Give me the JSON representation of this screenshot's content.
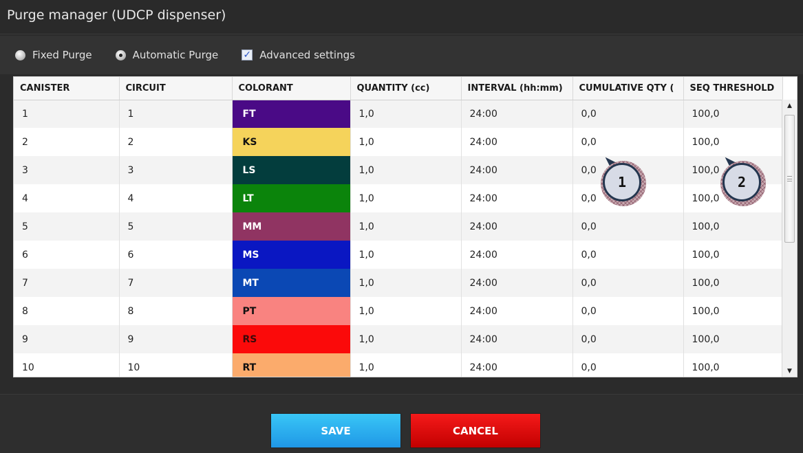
{
  "window": {
    "title": "Purge manager (UDCP dispenser)"
  },
  "options": {
    "fixed_purge": {
      "label": "Fixed Purge",
      "selected": false
    },
    "automatic_purge": {
      "label": "Automatic Purge",
      "selected": true
    },
    "advanced_settings": {
      "label": "Advanced settings",
      "checked": true
    }
  },
  "table": {
    "columns": [
      "CANISTER",
      "CIRCUIT",
      "COLORANT",
      "QUANTITY (cc)",
      "INTERVAL (hh:mm)",
      "CUMULATIVE QTY (",
      "SEQ THRESHOLD"
    ],
    "rows": [
      {
        "canister": "1",
        "circuit": "1",
        "colorant": "FT",
        "colorant_bg": "#4a0a86",
        "colorant_fg": "#ffffff",
        "quantity": "1,0",
        "interval": "24:00",
        "cumulative": "0,0",
        "threshold": "100,0"
      },
      {
        "canister": "2",
        "circuit": "2",
        "colorant": "KS",
        "colorant_bg": "#f5d35b",
        "colorant_fg": "#111111",
        "quantity": "1,0",
        "interval": "24:00",
        "cumulative": "0,0",
        "threshold": "100,0"
      },
      {
        "canister": "3",
        "circuit": "3",
        "colorant": "LS",
        "colorant_bg": "#033d3d",
        "colorant_fg": "#ffffff",
        "quantity": "1,0",
        "interval": "24:00",
        "cumulative": "0,0",
        "threshold": "100,0"
      },
      {
        "canister": "4",
        "circuit": "4",
        "colorant": "LT",
        "colorant_bg": "#0b840b",
        "colorant_fg": "#ffffff",
        "quantity": "1,0",
        "interval": "24:00",
        "cumulative": "0,0",
        "threshold": "100,0"
      },
      {
        "canister": "5",
        "circuit": "5",
        "colorant": "MM",
        "colorant_bg": "#903462",
        "colorant_fg": "#ffffff",
        "quantity": "1,0",
        "interval": "24:00",
        "cumulative": "0,0",
        "threshold": "100,0"
      },
      {
        "canister": "6",
        "circuit": "6",
        "colorant": "MS",
        "colorant_bg": "#0a17c2",
        "colorant_fg": "#ffffff",
        "quantity": "1,0",
        "interval": "24:00",
        "cumulative": "0,0",
        "threshold": "100,0"
      },
      {
        "canister": "7",
        "circuit": "7",
        "colorant": "MT",
        "colorant_bg": "#0b48b4",
        "colorant_fg": "#ffffff",
        "quantity": "1,0",
        "interval": "24:00",
        "cumulative": "0,0",
        "threshold": "100,0"
      },
      {
        "canister": "8",
        "circuit": "8",
        "colorant": "PT",
        "colorant_bg": "#f98380",
        "colorant_fg": "#111111",
        "quantity": "1,0",
        "interval": "24:00",
        "cumulative": "0,0",
        "threshold": "100,0"
      },
      {
        "canister": "9",
        "circuit": "9",
        "colorant": "RS",
        "colorant_bg": "#fb0a0a",
        "colorant_fg": "#3a0a0a",
        "quantity": "1,0",
        "interval": "24:00",
        "cumulative": "0,0",
        "threshold": "100,0"
      },
      {
        "canister": "10",
        "circuit": "10",
        "colorant": "RT",
        "colorant_bg": "#fbab6c",
        "colorant_fg": "#111111",
        "quantity": "1,0",
        "interval": "24:00",
        "cumulative": "0,0",
        "threshold": "100,0"
      }
    ]
  },
  "callouts": [
    {
      "label": "1"
    },
    {
      "label": "2"
    }
  ],
  "buttons": {
    "save": "SAVE",
    "cancel": "CANCEL"
  }
}
